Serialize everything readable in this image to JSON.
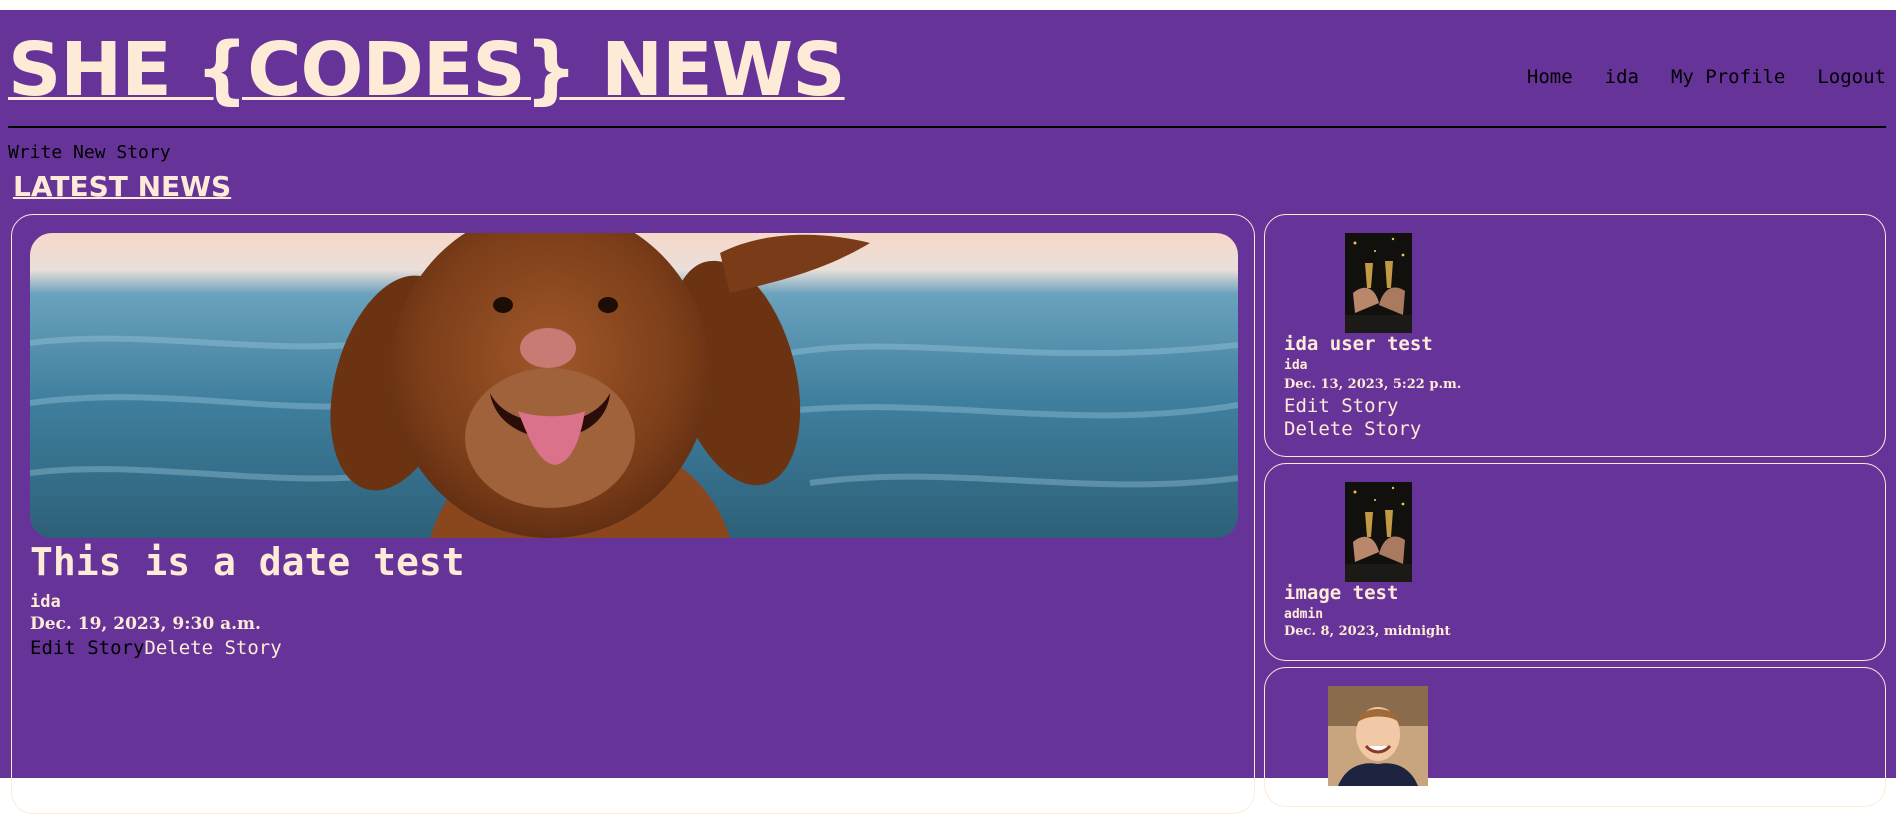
{
  "header": {
    "site_title": "SHE {CODES} NEWS",
    "nav": [
      "Home",
      "ida",
      "My Profile",
      "Logout"
    ]
  },
  "write_new_story": "Write New Story",
  "section_title": "LATEST NEWS",
  "featured": {
    "image": "dog-at-sea-image",
    "title": "This is a date test",
    "author": "ida",
    "date": "Dec. 19, 2023, 9:30 a.m.",
    "edit_label": "Edit Story",
    "delete_label": "Delete Story"
  },
  "stories": [
    {
      "image": "champagne-toast-image",
      "title": "ida user test",
      "author": "ida",
      "date": "Dec. 13, 2023, 5:22 p.m.",
      "edit_label": "Edit Story",
      "delete_label": "Delete Story"
    },
    {
      "image": "champagne-toast-image",
      "title": "image test",
      "author": "admin",
      "date": "Dec. 8, 2023, midnight"
    },
    {
      "image": "portrait-man-image"
    }
  ],
  "colors": {
    "background": "#663399",
    "text_cream": "#fdebd7",
    "nav_text": "#000000"
  }
}
